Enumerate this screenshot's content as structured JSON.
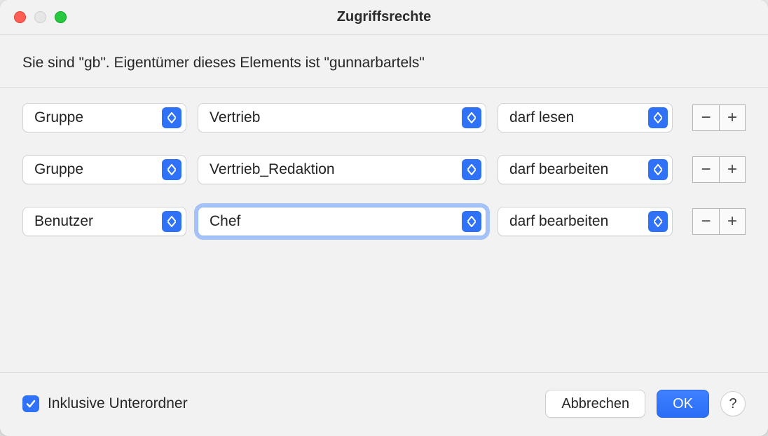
{
  "title": "Zugriffsrechte",
  "info_text": "Sie sind \"gb\". Eigentümer dieses Elements ist \"gunnarbartels\"",
  "rows": [
    {
      "type": "Gruppe",
      "name": "Vertrieb",
      "perm": "darf lesen",
      "focused": false
    },
    {
      "type": "Gruppe",
      "name": "Vertrieb_Redaktion",
      "perm": "darf bearbeiten",
      "focused": false
    },
    {
      "type": "Benutzer",
      "name": "Chef",
      "perm": "darf bearbeiten",
      "focused": true
    }
  ],
  "checkbox": {
    "label": "Inklusive Unterordner",
    "checked": true
  },
  "buttons": {
    "cancel": "Abbrechen",
    "ok": "OK",
    "help": "?"
  },
  "glyphs": {
    "minus": "−",
    "plus": "+"
  }
}
